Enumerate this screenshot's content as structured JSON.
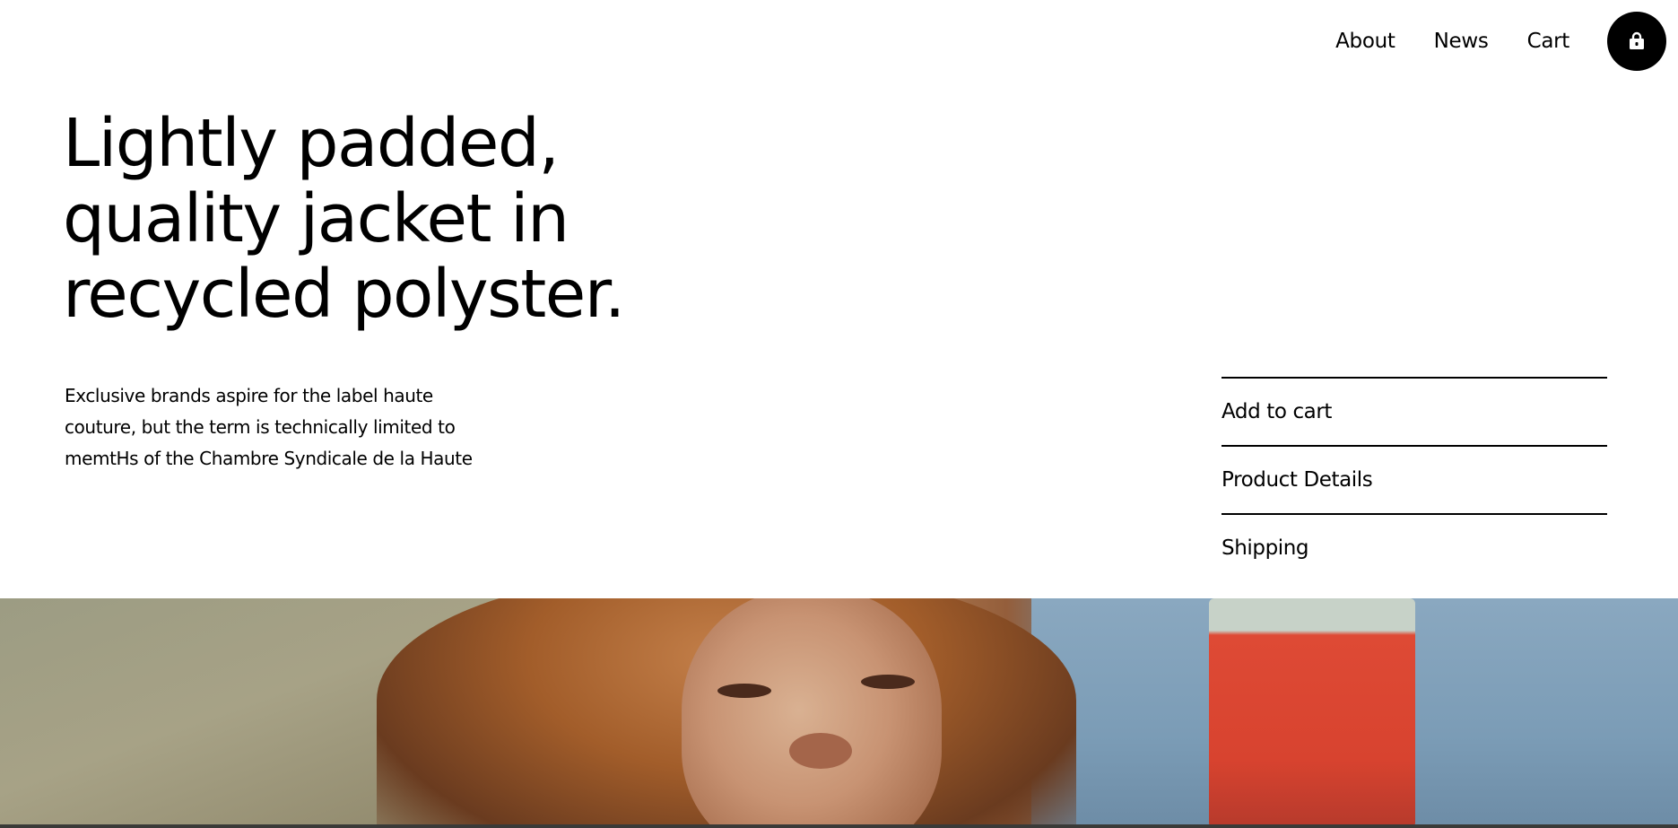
{
  "nav": {
    "links": [
      "About",
      "News",
      "Cart"
    ],
    "bag_icon": "shopping-bag-icon"
  },
  "hero_text": {
    "headline_lines": [
      "Lightly padded,",
      "quality jacket in",
      "recycled polyster."
    ],
    "intro_lines": [
      "Exclusive brands aspire for the label haute",
      "couture, but the term is technically limited to",
      "memtHs of the Chambre Syndicale de la Haute"
    ]
  },
  "accordion": {
    "items": [
      "Add to cart",
      "Product Details",
      "Shipping"
    ]
  },
  "colors": {
    "text": "#000000",
    "background": "#ffffff",
    "bag_button": "#000000"
  }
}
